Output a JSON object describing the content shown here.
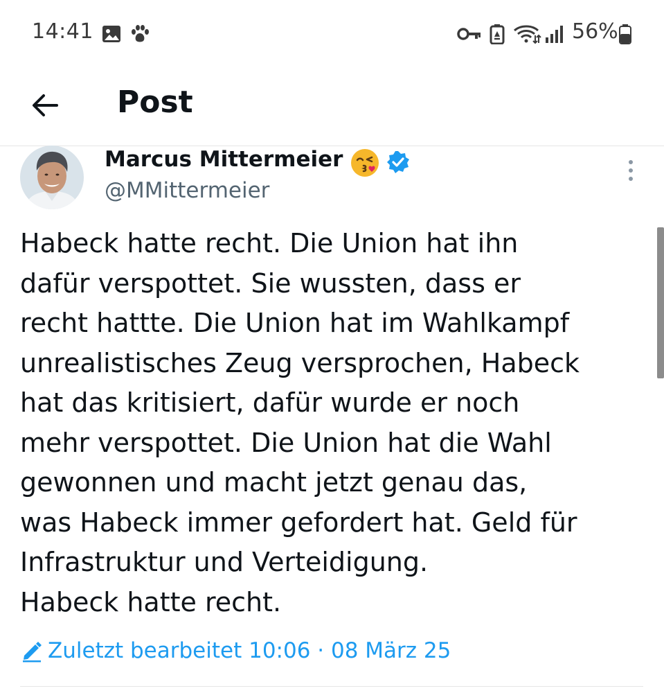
{
  "status_bar": {
    "time": "14:41",
    "battery_percent": "56%",
    "icons": [
      "gallery-icon",
      "paw-icon",
      "key-icon",
      "battery-saver-icon",
      "wifi-icon",
      "signal-icon",
      "battery-icon"
    ]
  },
  "header": {
    "back_icon": "back-arrow-icon",
    "title": "Post"
  },
  "post": {
    "author_name": "Marcus Mittermeier",
    "author_emoji": "😘",
    "verified": true,
    "handle": "@MMittermeier",
    "text": "Habeck hatte recht. Die Union hat ihn\ndafür verspottet. Sie wussten, dass er\nrecht hattte. Die Union hat im Wahlkampf\nunrealistisches Zeug versprochen, Habeck\nhat das kritisiert, dafür wurde er noch\nmehr verspottet. Die Union hat die Wahl\ngewonnen und macht jetzt genau das,\nwas Habeck immer gefordert hat. Geld für\nInfrastruktur und Verteidigung.\nHabeck hatte recht.",
    "edited_meta": "Zuletzt bearbeitet 10:06 · 08 März 25"
  },
  "colors": {
    "accent": "#1d9bf0",
    "text_primary": "#0f1419",
    "text_secondary": "#536471",
    "divider": "#e6e6e6"
  }
}
